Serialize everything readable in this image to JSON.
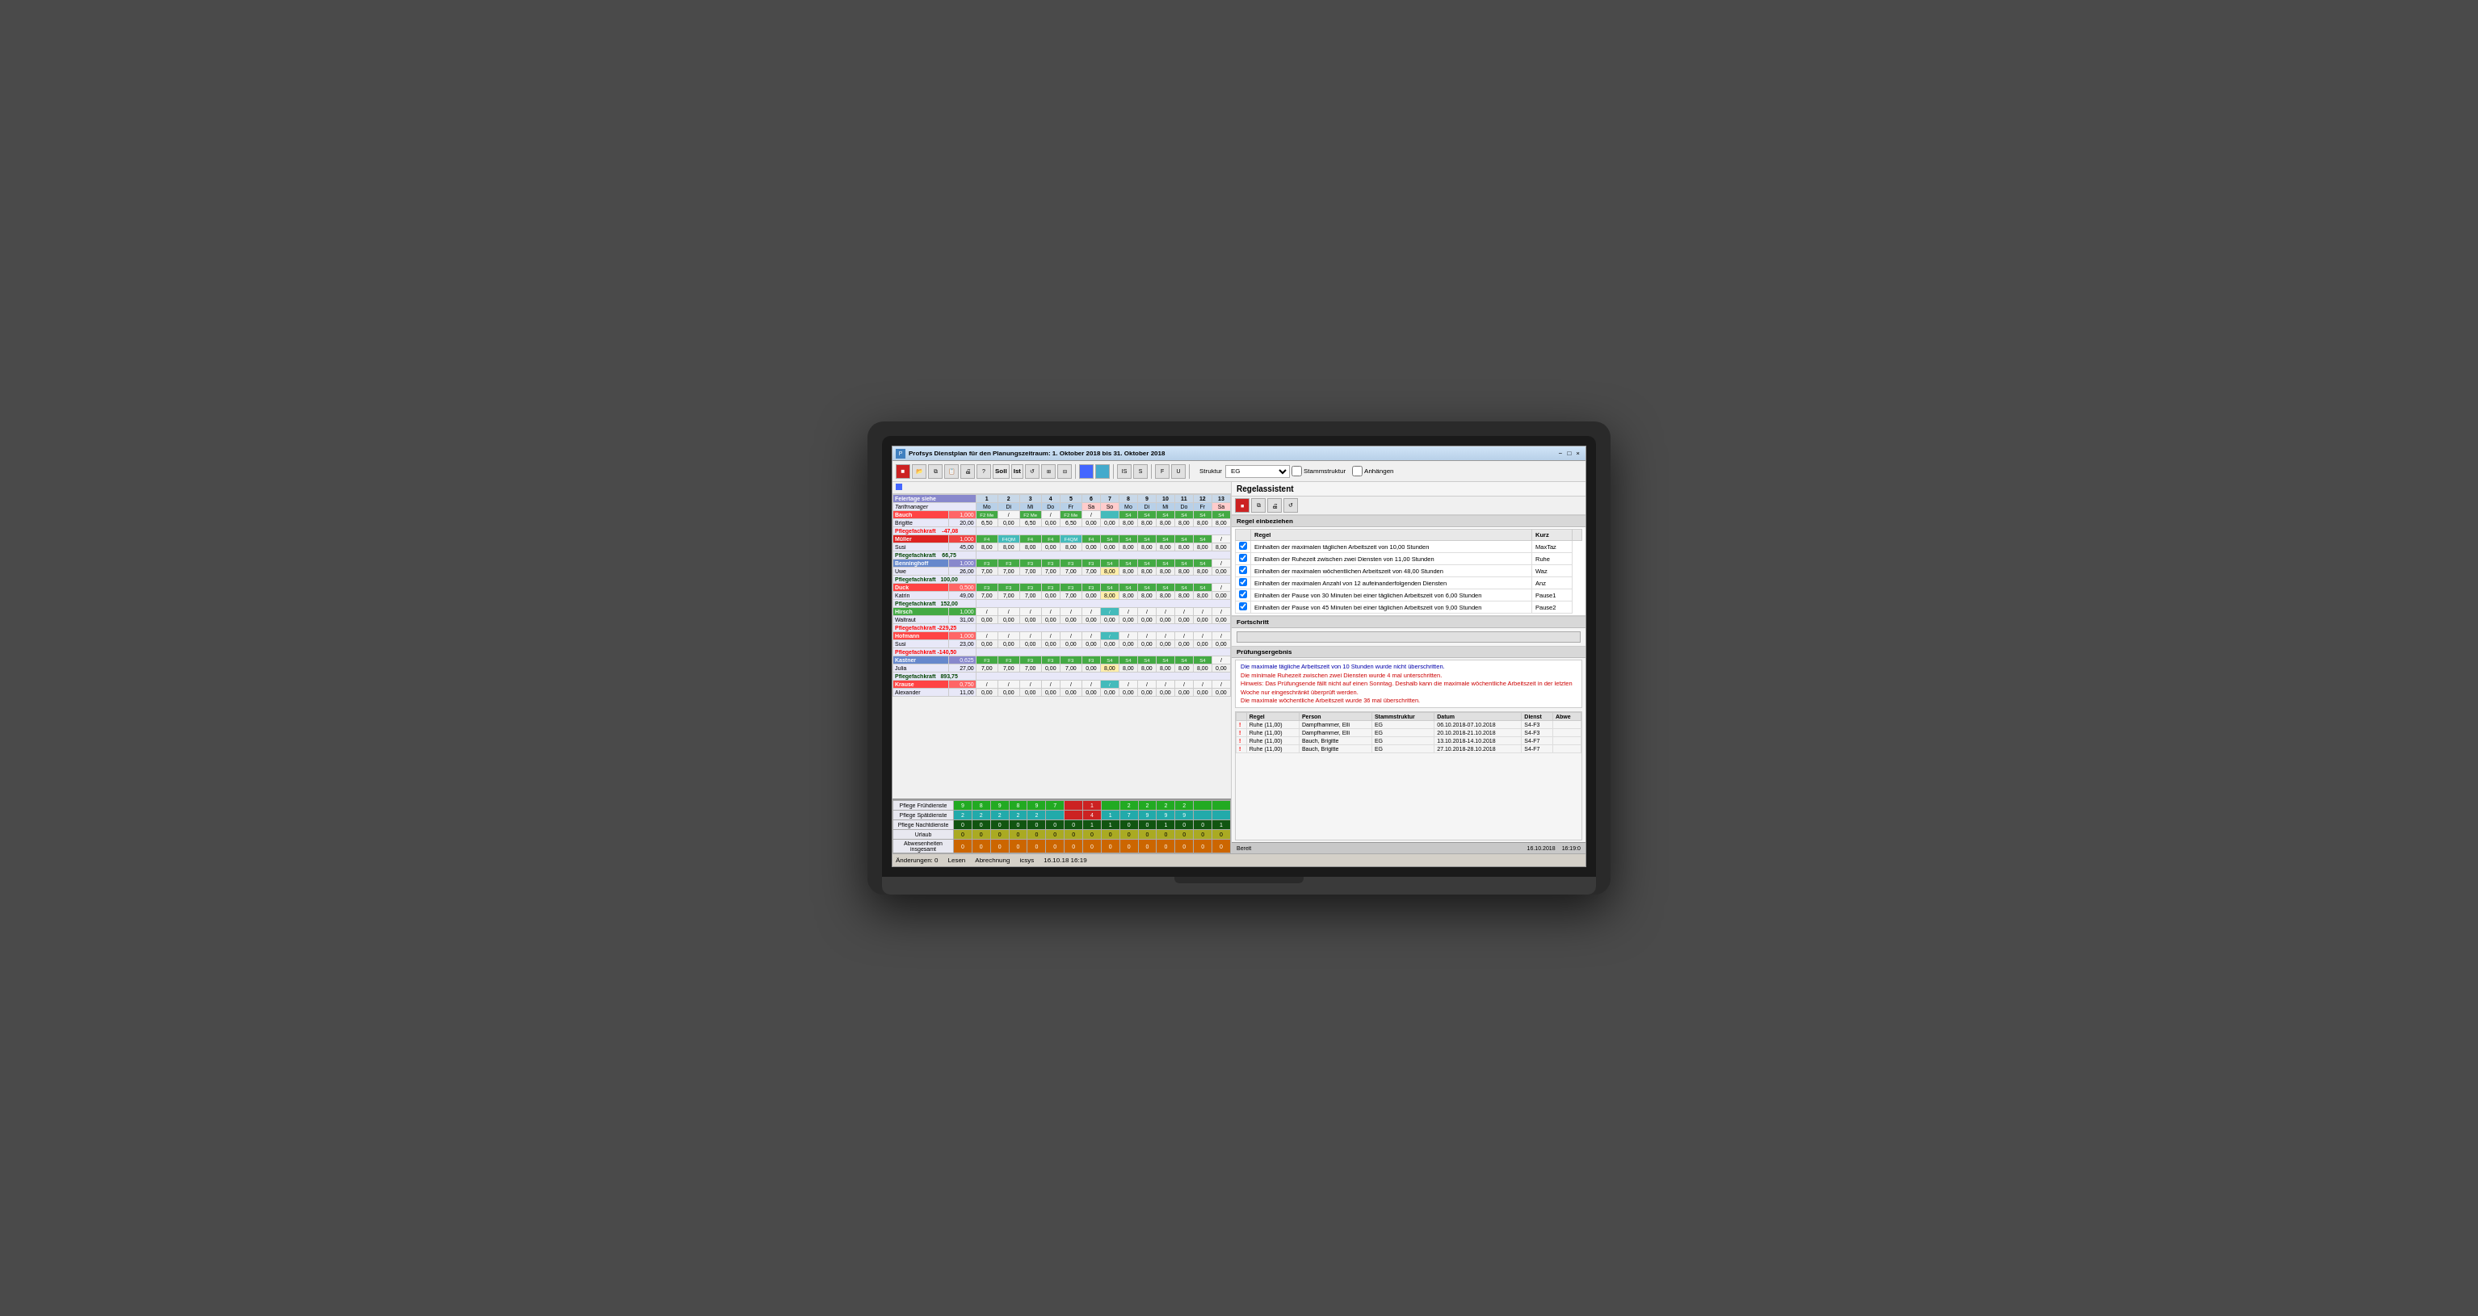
{
  "window": {
    "title": "Profsys Dienstplan  für den Planungszeitraum: 1. Oktober 2018 bis 31. Oktober 2018",
    "minimize": "−",
    "maximize": "□",
    "close": "×"
  },
  "toolbar": {
    "soll_label": "Soll",
    "ist_label": "Ist",
    "struktur_label": "Struktur",
    "struktur_value": "EG",
    "stammstruktur_label": "Stammstruktur",
    "anhaengen_label": "Anhängen"
  },
  "schedule": {
    "header": {
      "feiertage": "Feiertage siehe",
      "tarifmanager": "Tarifmanager",
      "days": [
        "1",
        "2",
        "3",
        "4",
        "5",
        "6",
        "7",
        "8",
        "9",
        "10",
        "11",
        "12",
        "13"
      ],
      "weekdays": [
        "Mo",
        "Di",
        "Mi",
        "Do",
        "Fr",
        "Sa",
        "So",
        "Mo",
        "Di",
        "Mi",
        "Do",
        "Fr",
        "Sa"
      ]
    },
    "employees": [
      {
        "name": "Bauch",
        "value": "1,000",
        "role": "Pflegefachkraft",
        "role_value": "-47,08",
        "shifts": [
          "F2 Me",
          "/",
          "F2 Me",
          "/",
          "F2 Me",
          "/",
          "",
          "S4",
          "S4",
          "S4",
          "S4",
          "S4",
          "S4"
        ],
        "hours": [
          "",
          "",
          "",
          "",
          "",
          "",
          "",
          "",
          "",
          "",
          "",
          "",
          ""
        ]
      },
      {
        "name": "Brigitte",
        "value": "20,00",
        "role": "",
        "role_value": "",
        "shifts": [],
        "hours": [
          "6,50",
          "0,00",
          "6,50",
          "0,00",
          "6,50",
          "0,00",
          "0,00",
          "8,00",
          "8,00",
          "8,00",
          "8,00",
          "8,00",
          "8,00"
        ]
      },
      {
        "name": "Müller",
        "value": "1,000",
        "role": "Pflegefachkraft",
        "role_value": "66,75",
        "shifts": [
          "F4",
          "F4QM",
          "F4",
          "F4",
          "F4QM",
          "F4",
          "S4",
          "S4",
          "S4",
          "S4",
          "S4",
          "S4",
          "/"
        ],
        "hours": [
          "",
          "",
          "",
          "",
          "",
          "",
          "",
          "",
          "",
          "",
          "",
          "",
          ""
        ]
      },
      {
        "name": "Susi",
        "value": "45,00",
        "role": "",
        "role_value": "",
        "shifts": [],
        "hours": [
          "8,00",
          "8,00",
          "8,00",
          "0,00",
          "8,00",
          "0,00",
          "0,00",
          "8,00",
          "8,00",
          "8,00",
          "8,00",
          "8,00",
          "8,00"
        ]
      },
      {
        "name": "Benninghoff",
        "value": "1,000",
        "role": "Pflegefachkraft",
        "role_value": "100,00",
        "shifts": [
          "F3",
          "F3",
          "F3",
          "F3",
          "F3",
          "F3",
          "S4",
          "S4",
          "S4",
          "S4",
          "S4",
          "S4",
          "/"
        ],
        "hours": []
      },
      {
        "name": "Uwe",
        "value": "26,00",
        "role": "",
        "role_value": "",
        "shifts": [],
        "hours": [
          "7,00",
          "7,00",
          "7,00",
          "7,00",
          "7,00",
          "7,00",
          "8,00",
          "8,00",
          "8,00",
          "8,00",
          "8,00",
          "8,00",
          "0,00"
        ]
      },
      {
        "name": "Duck",
        "value": "0,500",
        "role": "Pflegefachkraft",
        "role_value": "152,00",
        "shifts": [
          "F3",
          "F3",
          "F3",
          "F3",
          "F3",
          "F3",
          "S4",
          "S4",
          "S4",
          "S4",
          "S4",
          "S4",
          "/"
        ],
        "hours": []
      },
      {
        "name": "Katrin",
        "value": "49,00",
        "role": "",
        "role_value": "",
        "shifts": [],
        "hours": [
          "7,00",
          "7,00",
          "7,00",
          "0,00",
          "7,00",
          "0,00",
          "8,00",
          "8,00",
          "8,00",
          "8,00",
          "8,00",
          "8,00",
          "0,00"
        ]
      },
      {
        "name": "Hirsch",
        "value": "1,000",
        "role": "Pflegefachkraft",
        "role_value": "-229,25",
        "shifts": [
          "/",
          "/",
          "/",
          "/",
          "/",
          "/",
          "/",
          "/",
          "/",
          "/",
          "/",
          "/",
          "/"
        ],
        "hours": []
      },
      {
        "name": "Waltraut",
        "value": "31,00",
        "role": "",
        "role_value": "",
        "shifts": [],
        "hours": [
          "0,00",
          "0,00",
          "0,00",
          "0,00",
          "0,00",
          "0,00",
          "0,00",
          "0,00",
          "0,00",
          "0,00",
          "0,00",
          "0,00",
          "0,00"
        ]
      },
      {
        "name": "Hofmann",
        "value": "1,000",
        "role": "Pflegefachkraft",
        "role_value": "-140,50",
        "shifts": [
          "/",
          "/",
          "/",
          "/",
          "/",
          "/",
          "/",
          "/",
          "/",
          "/",
          "/",
          "/",
          "/"
        ],
        "hours": []
      },
      {
        "name": "Susi",
        "value": "23,00",
        "role": "",
        "role_value": "",
        "shifts": [],
        "hours": [
          "0,00",
          "0,00",
          "0,00",
          "0,00",
          "0,00",
          "0,00",
          "0,00",
          "0,00",
          "0,00",
          "0,00",
          "0,00",
          "0,00",
          "0,00"
        ]
      },
      {
        "name": "Kastner",
        "value": "0,625",
        "role": "Pflegefachkraft",
        "role_value": "893,75",
        "shifts": [
          "F3",
          "F3",
          "F3",
          "F3",
          "F3",
          "F3",
          "S4",
          "S4",
          "S4",
          "S4",
          "S4",
          "S4",
          "/"
        ],
        "hours": []
      },
      {
        "name": "Julia",
        "value": "27,00",
        "role": "",
        "role_value": "",
        "shifts": [],
        "hours": [
          "7,00",
          "7,00",
          "7,00",
          "0,00",
          "7,00",
          "0,00",
          "8,00",
          "8,00",
          "8,00",
          "8,00",
          "8,00",
          "8,00",
          "0,00"
        ]
      },
      {
        "name": "Krause",
        "value": "0,750",
        "role": "",
        "role_value": "",
        "shifts": [],
        "hours": []
      },
      {
        "name": "Alexander",
        "value": "11,00",
        "role": "",
        "role_value": "",
        "shifts": [],
        "hours": [
          "0,00",
          "0,00",
          "0,00",
          "0,00",
          "0,00",
          "0,00",
          "0,00",
          "0,00",
          "0,00",
          "0,00",
          "0,00",
          "0,00",
          "0,00"
        ]
      }
    ]
  },
  "stats": {
    "rows": [
      {
        "label": "Pflege Frühdienste",
        "values": [
          "9",
          "8",
          "9",
          "8",
          "9",
          "7",
          "",
          "1",
          "",
          "2",
          "2",
          "2",
          "2",
          "",
          "",
          ""
        ]
      },
      {
        "label": "Pflege Spätdienste",
        "values": [
          "2",
          "2",
          "2",
          "2",
          "2",
          "",
          "",
          "4",
          "1",
          "7",
          "9",
          "9",
          "9",
          "",
          "",
          ""
        ]
      },
      {
        "label": "Pflege Nachtdienste",
        "values": [
          "0",
          "0",
          "0",
          "0",
          "0",
          "0",
          "0",
          "1",
          "1",
          "0",
          "0",
          "1",
          "0",
          "0",
          "0"
        ]
      },
      {
        "label": "Urlaub",
        "values": [
          "0",
          "0",
          "0",
          "0",
          "0",
          "0",
          "0",
          "0",
          "0",
          "0",
          "0",
          "0",
          "0",
          "0",
          "0"
        ]
      },
      {
        "label": "Abwesenheiten insgesamt",
        "values": [
          "0",
          "0",
          "0",
          "0",
          "0",
          "0",
          "0",
          "0",
          "0",
          "0",
          "0",
          "0",
          "0",
          "0",
          "0"
        ]
      }
    ]
  },
  "regel": {
    "title": "Regelassistent",
    "abschnitt": "Regel einbeziehen",
    "rules": [
      {
        "checked": true,
        "text": "Einhalten der maximalen täglichen Arbeitszeit von 10,00 Stunden",
        "kurz": "MaxTaz"
      },
      {
        "checked": true,
        "text": "Einhalten der Ruhezeit zwischen zwei Diensten von 11,00 Stunden",
        "kurz": "Ruhe"
      },
      {
        "checked": true,
        "text": "Einhalten der maximalen wöchentlichen Arbeitszeit von 48,00 Stunden",
        "kurz": "Waz"
      },
      {
        "checked": true,
        "text": "Einhalten der maximalen Anzahl von 12 aufeinanderfolgenden Diensten",
        "kurz": "Anz"
      },
      {
        "checked": true,
        "text": "Einhalten der Pause von 30 Minuten bei einer täglichen Arbeitszeit von 6,00 Stunden",
        "kurz": "Pause1"
      },
      {
        "checked": true,
        "text": "Einhalten der Pause von 45 Minuten bei einer täglichen Arbeitszeit von 9,00 Stunden",
        "kurz": "Pause2"
      }
    ],
    "fortschritt_title": "Fortschritt",
    "pruefung_title": "Prüfungsergebnis",
    "pruefung_messages": [
      {
        "color": "blue",
        "text": "Die maximale tägliche Arbeitszeit von 10 Stunden wurde nicht überschritten."
      },
      {
        "color": "red",
        "text": "Die minimale Ruhezeit zwischen zwei Diensten wurde 4 mal unterschritten."
      },
      {
        "color": "red",
        "text": "Hinweis: Das Prüfungsende fällt nicht auf einen Sonntag. Deshalb kann die maximale wöchentliche Arbeitszeit in der letzten Woche nur eingeschränkt überprüft werden."
      },
      {
        "color": "red",
        "text": "Die maximale wöchentliche Arbeitszeit wurde 36 mal überschritten."
      }
    ],
    "result_columns": [
      "Regel",
      "Person",
      "Stammstruktur",
      "Datum",
      "Dienst",
      "Abwe"
    ],
    "results": [
      {
        "icon": "!",
        "regel": "Ruhe (11,00)",
        "person": "Dampfhammer, Elli",
        "struktur": "EG",
        "datum": "06.10.2018-07.10.2018",
        "dienst": "S4-F3",
        "abwe": ""
      },
      {
        "icon": "!",
        "regel": "Ruhe (11,00)",
        "person": "Dampfhammer, Elli",
        "struktur": "EG",
        "datum": "20.10.2018-21.10.2018",
        "dienst": "S4-F3",
        "abwe": ""
      },
      {
        "icon": "!",
        "regel": "Ruhe (11,00)",
        "person": "Bauch, Brigitte",
        "struktur": "EG",
        "datum": "13.10.2018-14.10.2018",
        "dienst": "S4-F7",
        "abwe": ""
      },
      {
        "icon": "!",
        "regel": "Ruhe (11,00)",
        "person": "Bauch, Brigitte",
        "struktur": "EG",
        "datum": "27.10.2018-28.10.2018",
        "dienst": "S4-F7",
        "abwe": ""
      }
    ],
    "bereit_label": "Bereit",
    "bereit_date": "16.10.2018",
    "bereit_time": "16:19:0"
  },
  "statusbar": {
    "aenderungen": "Änderungen: 0",
    "lesen": "Lesen",
    "abrechnung": "Abrechnung",
    "user": "icsys",
    "datetime": "16.10.18 16:19"
  }
}
